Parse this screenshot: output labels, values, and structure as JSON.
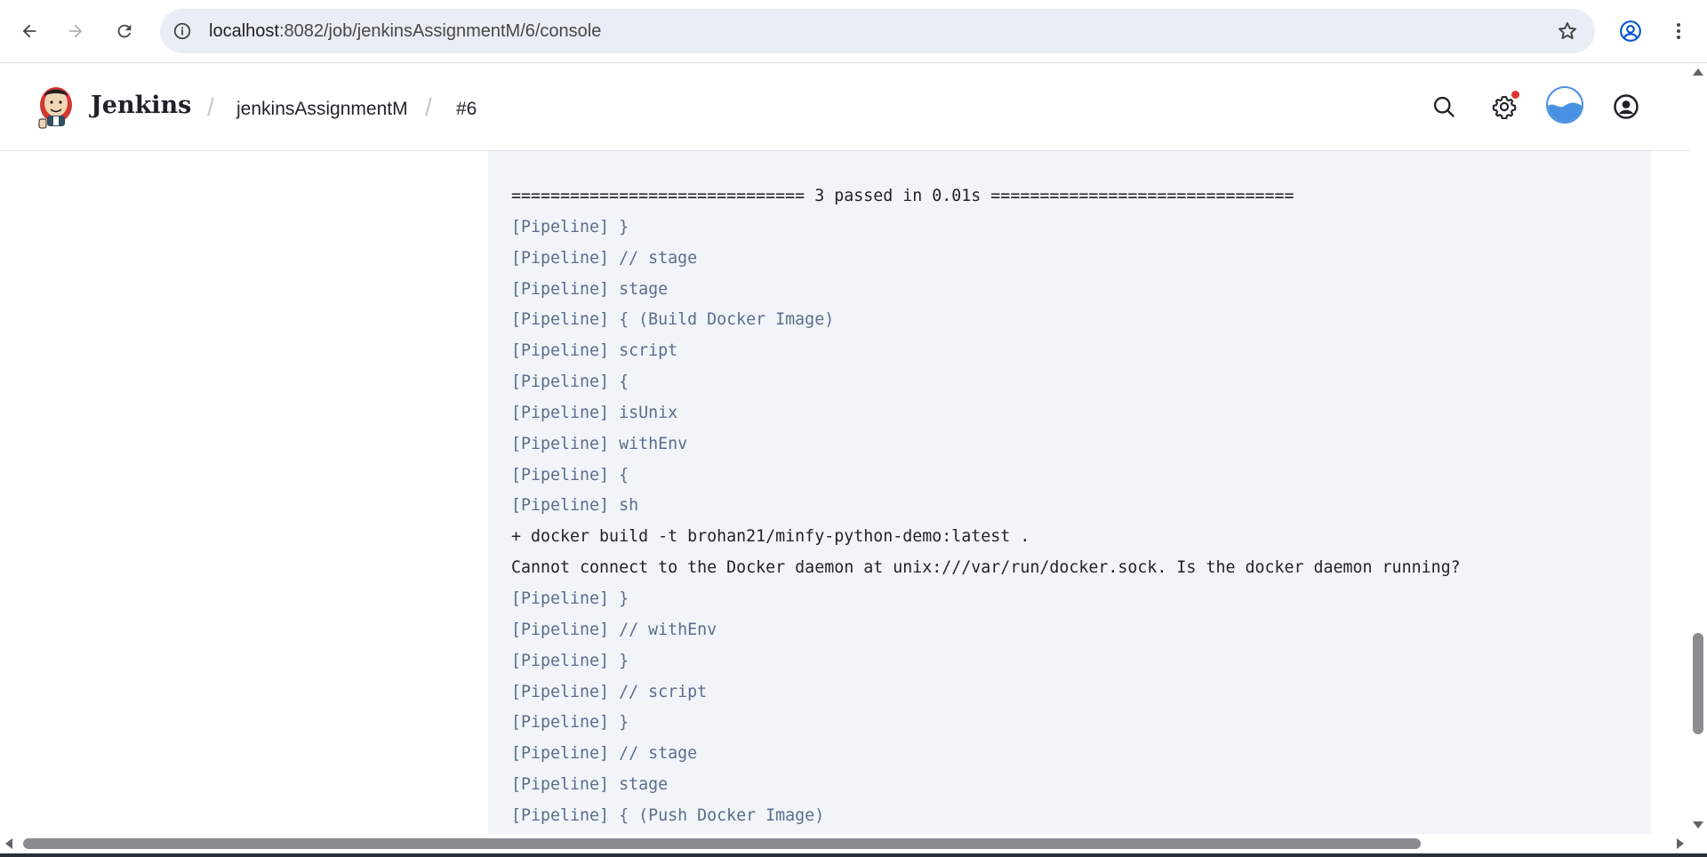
{
  "browser": {
    "url_host": "localhost",
    "url_path": ":8082/job/jenkinsAssignmentM/6/console",
    "icons": [
      "back-arrow-icon",
      "forward-arrow-icon",
      "reload-icon",
      "site-info-icon",
      "bookmark-star-icon",
      "profile-icon",
      "more-vertical-icon"
    ]
  },
  "header": {
    "title": "Jenkins",
    "breadcrumbs": [
      {
        "label": "jenkinsAssignmentM"
      },
      {
        "label": "#6"
      }
    ],
    "separator": "/",
    "icons": [
      "search-icon",
      "settings-gear-icon",
      "water-avatar-icon",
      "user-account-icon"
    ],
    "notification_color": "#e03131"
  },
  "console": {
    "lines": [
      {
        "type": "plain",
        "text": "============================== 3 passed in 0.01s ==============================="
      },
      {
        "type": "pipeline",
        "text": "[Pipeline] }"
      },
      {
        "type": "pipeline",
        "text": "[Pipeline] // stage"
      },
      {
        "type": "pipeline",
        "text": "[Pipeline] stage"
      },
      {
        "type": "pipeline",
        "text": "[Pipeline] { (Build Docker Image)"
      },
      {
        "type": "pipeline",
        "text": "[Pipeline] script"
      },
      {
        "type": "pipeline",
        "text": "[Pipeline] {"
      },
      {
        "type": "pipeline",
        "text": "[Pipeline] isUnix"
      },
      {
        "type": "pipeline",
        "text": "[Pipeline] withEnv"
      },
      {
        "type": "pipeline",
        "text": "[Pipeline] {"
      },
      {
        "type": "pipeline",
        "text": "[Pipeline] sh"
      },
      {
        "type": "plain",
        "text": "+ docker build -t brohan21/minfy-python-demo:latest ."
      },
      {
        "type": "plain",
        "text": "Cannot connect to the Docker daemon at unix:///var/run/docker.sock. Is the docker daemon running?"
      },
      {
        "type": "pipeline",
        "text": "[Pipeline] }"
      },
      {
        "type": "pipeline",
        "text": "[Pipeline] // withEnv"
      },
      {
        "type": "pipeline",
        "text": "[Pipeline] }"
      },
      {
        "type": "pipeline",
        "text": "[Pipeline] // script"
      },
      {
        "type": "pipeline",
        "text": "[Pipeline] }"
      },
      {
        "type": "pipeline",
        "text": "[Pipeline] // stage"
      },
      {
        "type": "pipeline",
        "text": "[Pipeline] stage"
      },
      {
        "type": "pipeline",
        "text": "[Pipeline] { (Push Docker Image)"
      }
    ]
  }
}
